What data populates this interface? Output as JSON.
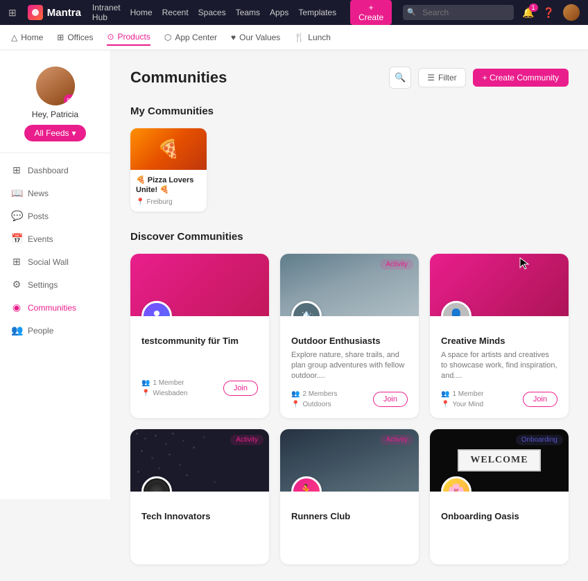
{
  "topnav": {
    "logo": "Mantra",
    "links": [
      "Intranet Hub",
      "Home",
      "Recent",
      "Spaces",
      "Teams",
      "Apps",
      "Templates"
    ],
    "create_label": "+ Create",
    "search_placeholder": "Search",
    "notification_badge": "1"
  },
  "secnav": {
    "items": [
      {
        "label": "Home",
        "icon": "△",
        "active": false
      },
      {
        "label": "Offices",
        "icon": "⊞",
        "active": false
      },
      {
        "label": "Products",
        "icon": "⊙",
        "active": true
      },
      {
        "label": "App Center",
        "icon": "⬡",
        "active": false
      },
      {
        "label": "Our Values",
        "icon": "♥",
        "active": false
      },
      {
        "label": "Lunch",
        "icon": "🍴",
        "active": false
      }
    ]
  },
  "sidebar": {
    "username": "Hey, Patricia",
    "feeds_btn": "All Feeds",
    "nav_items": [
      {
        "label": "Dashboard",
        "icon": "⊞",
        "active": false
      },
      {
        "label": "News",
        "icon": "📖",
        "active": false
      },
      {
        "label": "Posts",
        "icon": "💬",
        "active": false
      },
      {
        "label": "Events",
        "icon": "📅",
        "active": false
      },
      {
        "label": "Social Wall",
        "icon": "⊞",
        "active": false
      },
      {
        "label": "Settings",
        "icon": "⚙",
        "active": false
      },
      {
        "label": "Communities",
        "icon": "◉",
        "active": true
      },
      {
        "label": "People",
        "icon": "👥",
        "active": false
      }
    ]
  },
  "page": {
    "title": "Communities",
    "filter_label": "Filter",
    "create_label": "+ Create Community",
    "my_communities_title": "My Communities",
    "discover_title": "Discover Communities"
  },
  "my_communities": [
    {
      "name": "Pizza Lovers Unite! 🍕",
      "location": "Freiburg",
      "bg": "pizza"
    }
  ],
  "discover_communities": [
    {
      "name": "testcommunity für Tim",
      "description": "",
      "members": "1 Member",
      "location": "Wiesbaden",
      "badge": "",
      "avatar_type": "testcommunity"
    },
    {
      "name": "Outdoor Enthusiasts",
      "description": "Explore nature, share trails, and plan group adventures with fellow outdoor....",
      "members": "2 Members",
      "location": "Outdoors",
      "badge": "Activity",
      "avatar_type": "outdoor"
    },
    {
      "name": "Creative Minds",
      "description": "A space for artists and creatives to showcase work, find inspiration, and....",
      "members": "1 Member",
      "location": "Your Mind",
      "badge": "",
      "avatar_type": "creative"
    },
    {
      "name": "Tech Innovators",
      "description": "",
      "members": "",
      "location": "",
      "badge": "Activity",
      "avatar_type": "tech"
    },
    {
      "name": "Runners Club",
      "description": "",
      "members": "",
      "location": "",
      "badge": "Activity",
      "avatar_type": "runners"
    },
    {
      "name": "Onboarding Oasis",
      "description": "",
      "members": "",
      "location": "",
      "badge": "Onboarding",
      "avatar_type": "onboarding"
    }
  ],
  "join_label": "Join"
}
